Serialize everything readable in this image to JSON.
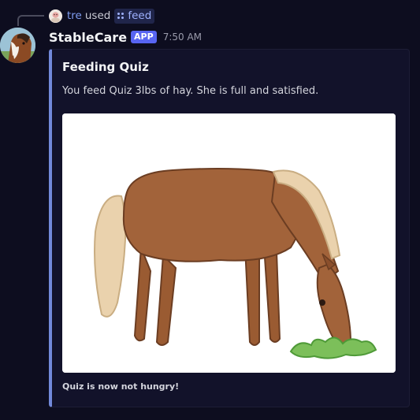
{
  "reply": {
    "username": "tre",
    "action": "used",
    "command": "feed"
  },
  "message": {
    "author": "StableCare",
    "badge": "APP",
    "timestamp": "7:50 AM"
  },
  "embed": {
    "title": "Feeding Quiz",
    "description": "You feed Quiz 3lbs of hay. She is full and satisfied.",
    "image_subject": "horse-grazing-drawing",
    "footer": "Quiz is now not hungry!",
    "accent_color": "#7289da"
  },
  "colors": {
    "background": "#0d0d1f",
    "embed_background": "#12122a",
    "link": "#7f9cf0",
    "badge": "#5865f2"
  }
}
